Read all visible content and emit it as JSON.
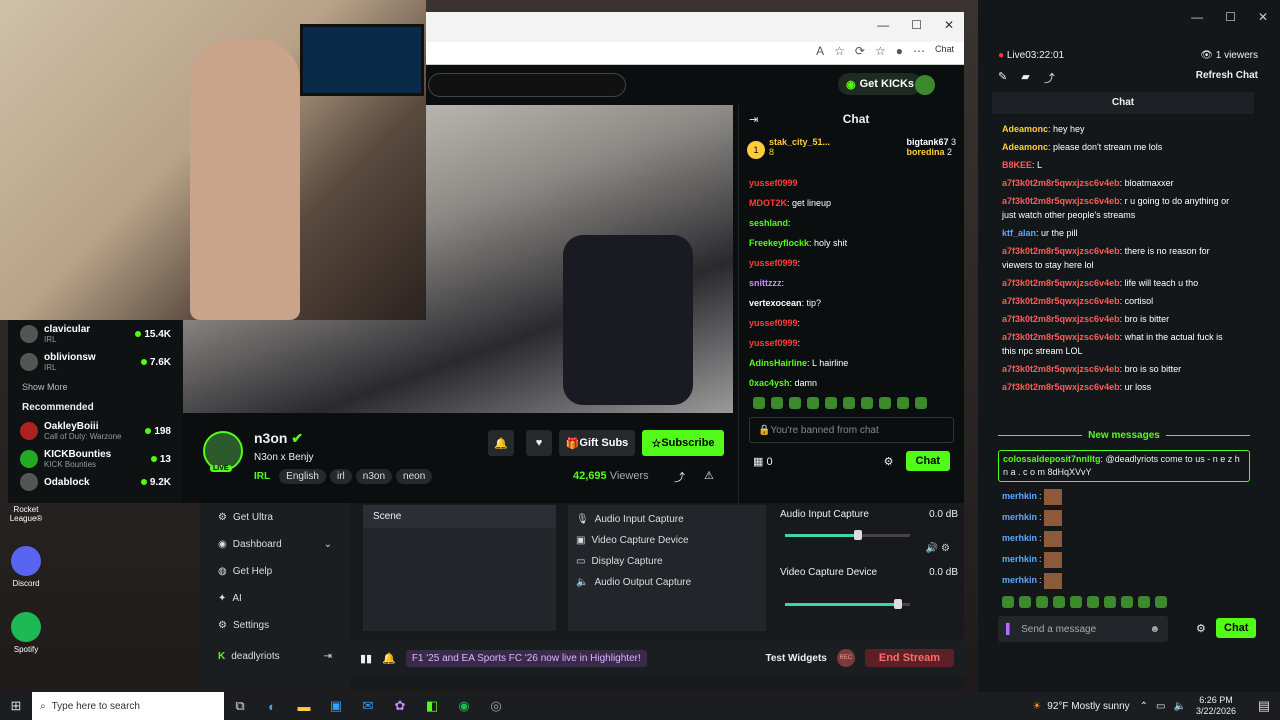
{
  "browser": {
    "address_icons": [
      "A",
      "☆",
      "⟳",
      "☆",
      "●",
      "⋯"
    ],
    "copilot_label": "Chat"
  },
  "kick": {
    "get_kicks_label": "Get KICKs",
    "sidebar": {
      "following": [
        {
          "name": "clavicular",
          "category": "IRL",
          "viewers": "15.4K"
        },
        {
          "name": "oblivionsw",
          "category": "IRL",
          "viewers": "7.6K"
        }
      ],
      "show_more": "Show More",
      "recommended_title": "Recommended",
      "recommended": [
        {
          "name": "OakleyBoiii",
          "category": "Call of Duty: Warzone",
          "viewers": "198"
        },
        {
          "name": "KICKBounties",
          "category": "KICK Bounties",
          "viewers": "13"
        },
        {
          "name": "Odablock",
          "category": "",
          "viewers": "9.2K"
        }
      ]
    },
    "stream": {
      "channel": "n3on",
      "title": "N3on x Benjy",
      "category": "IRL",
      "tags": [
        "English",
        "irl",
        "n3on",
        "neon"
      ],
      "live_badge": "LIVE",
      "viewers": "42,695",
      "viewers_label": "Viewers",
      "gift_label": "Gift Subs",
      "subscribe_label": "Subscribe"
    },
    "chat": {
      "title": "Chat",
      "top_gifter": "stak_city_51...",
      "top_gifter_count": "8",
      "gifters": [
        {
          "name": "bigtank67",
          "count": "3"
        },
        {
          "name": "boredina",
          "count": "2"
        }
      ],
      "messages": [
        {
          "user": "yussef0999",
          "text": "",
          "color": "#ff3c3c"
        },
        {
          "user": "MDOT2K",
          "text": ": get lineup",
          "color": "#ff3c3c"
        },
        {
          "user": "seshland",
          "text": ":",
          "color": "#53fc18"
        },
        {
          "user": "Freekeyflockk",
          "text": ": holy shit",
          "color": "#53fc18"
        },
        {
          "user": "yussef0999",
          "text": ":",
          "color": "#ff3c3c"
        },
        {
          "user": "snittzzz",
          "text": ":",
          "color": "#c88cff"
        },
        {
          "user": "vertexocean",
          "text": ": tip?",
          "color": "#ffffff"
        },
        {
          "user": "yussef0999",
          "text": ":",
          "color": "#ff3c3c"
        },
        {
          "user": "yussef0999",
          "text": ":",
          "color": "#ff3c3c"
        },
        {
          "user": "AdinsHairline",
          "text": ": L hairline",
          "color": "#53fc18"
        },
        {
          "user": "0xac4ysh",
          "text": ": damn",
          "color": "#53fc18"
        }
      ],
      "banned_placeholder": "You're banned from chat",
      "kicks_count": "0",
      "send_label": "Chat"
    }
  },
  "obs": {
    "nav": [
      "Get Ultra",
      "Dashboard",
      "Get Help",
      "AI",
      "Settings"
    ],
    "account": "deadlyriots",
    "scene_label": "Scene",
    "sources": [
      "Audio Input Capture",
      "Video Capture Device",
      "Display Capture",
      "Audio Output Capture"
    ],
    "mixer": [
      {
        "name": "Audio Input Capture",
        "db": "0.0 dB",
        "level": 0.58
      },
      {
        "name": "Video Capture Device",
        "db": "0.0 dB",
        "level": 0.9
      }
    ],
    "highlighter_msg": "F1 '25 and EA Sports FC '26 now live in Highlighter!",
    "test_widgets": "Test Widgets",
    "rec_label": "REC",
    "end_stream": "End Stream"
  },
  "right_chat": {
    "live_label": "Live",
    "live_time": "03:22:01",
    "viewers": "1 viewers",
    "refresh": "Refresh Chat",
    "title": "Chat",
    "messages": [
      {
        "user": "Adeamonc",
        "text": ": hey hey",
        "color": "#ffcd3c"
      },
      {
        "user": "Adeamonc",
        "text": ": please don't stream me lols",
        "color": "#ffcd3c"
      },
      {
        "user": "B8KEE",
        "text": ": L",
        "color": "#ff5a5a"
      },
      {
        "user": "a7f3k0t2m8r5qwxjzsc6v4eb",
        "text": ": bloatmaxxer",
        "color": "#ff5a5a"
      },
      {
        "user": "a7f3k0t2m8r5qwxjzsc6v4eb",
        "text": ": r u going to do anything or just watch other people's streams",
        "color": "#ff5a5a"
      },
      {
        "user": "ktf_alan",
        "text": ": ur the pill",
        "color": "#5aa8ff"
      },
      {
        "user": "a7f3k0t2m8r5qwxjzsc6v4eb",
        "text": ": there is no reason for viewers to stay here lol",
        "color": "#ff5a5a"
      },
      {
        "user": "a7f3k0t2m8r5qwxjzsc6v4eb",
        "text": ": life will teach u tho",
        "color": "#ff5a5a"
      },
      {
        "user": "a7f3k0t2m8r5qwxjzsc6v4eb",
        "text": ": cortisol",
        "color": "#ff5a5a"
      },
      {
        "user": "a7f3k0t2m8r5qwxjzsc6v4eb",
        "text": ": bro is bitter",
        "color": "#ff5a5a"
      },
      {
        "user": "a7f3k0t2m8r5qwxjzsc6v4eb",
        "text": ": what in the actual fuck is this npc stream LOL",
        "color": "#ff5a5a"
      },
      {
        "user": "a7f3k0t2m8r5qwxjzsc6v4eb",
        "text": ": bro is so bitter",
        "color": "#ff5a5a"
      },
      {
        "user": "a7f3k0t2m8r5qwxjzsc6v4eb",
        "text": ": ur loss",
        "color": "#ff5a5a"
      }
    ],
    "new_messages": "New messages",
    "highlight": {
      "user": "colossaldeposit7nnlltg",
      "text": ": @deadlyriots come to us - n e z h n a . c o m 8dHqXVvY"
    },
    "emote_msgs": [
      "merhkin",
      "merhkin",
      "merhkin",
      "merhkin",
      "merhkin"
    ],
    "input_placeholder": "Send a message",
    "send_label": "Chat"
  },
  "desktop": [
    {
      "name": "Rocket League®",
      "color": "#3a6ea5"
    },
    {
      "name": "Discord",
      "color": "#5865f2"
    },
    {
      "name": "Spotify",
      "color": "#1db954"
    }
  ],
  "taskbar": {
    "search_placeholder": "Type here to search",
    "weather": "92°F  Mostly sunny",
    "time": "6:26 PM",
    "date": "3/22/2026"
  }
}
